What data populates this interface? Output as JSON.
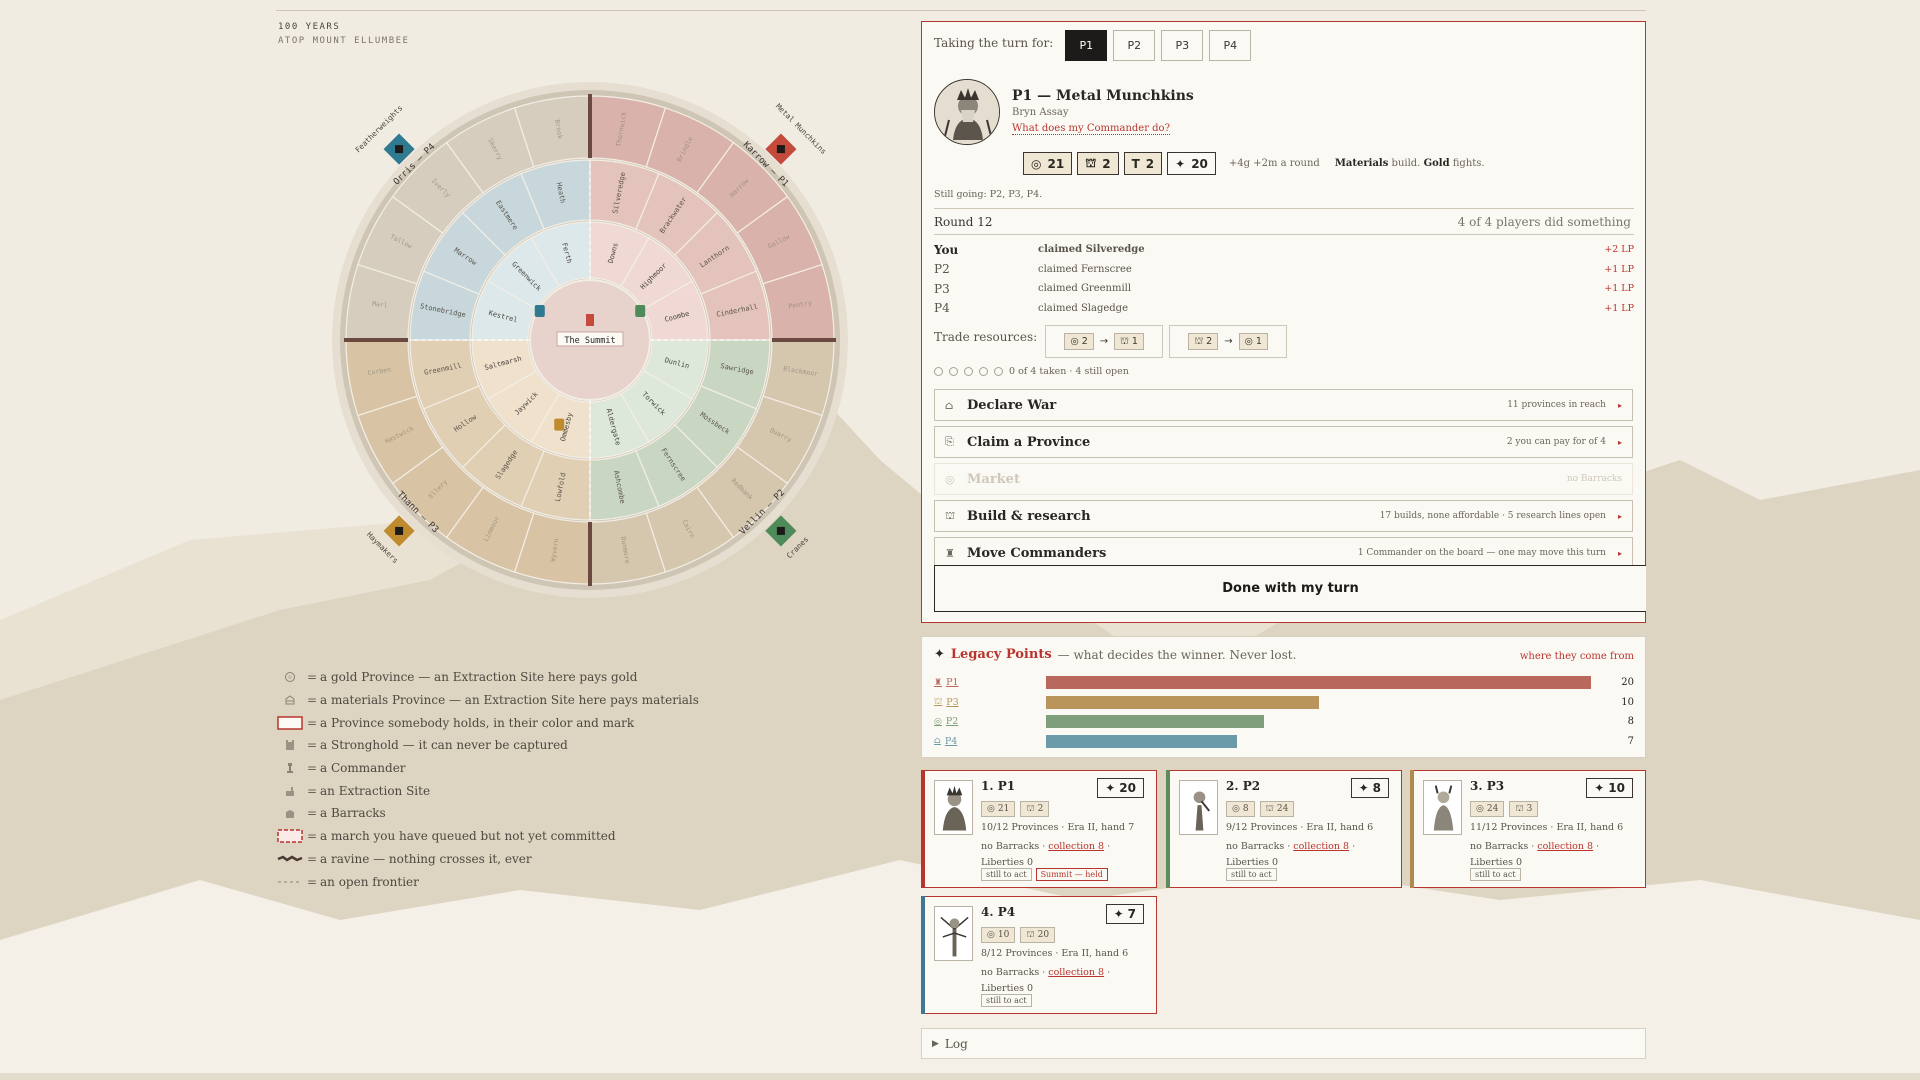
{
  "header": {
    "line1": "100 YEARS",
    "line2": "ATOP MOUNT ELLUMBEE"
  },
  "board": {
    "center_label": "The Summit",
    "corners": {
      "nw_region": "Orris — P4",
      "nw_faction": "Featherweights",
      "ne_region": "Karrow — P1",
      "ne_faction": "Metal Munchkins",
      "sw_region": "Thann — P3",
      "sw_faction": "Haymakers",
      "se_region": "Vellin — P2",
      "se_faction": "Cranes"
    },
    "inner_ring": [
      "Downs",
      "Highmoor",
      "Coombe",
      "Dunlin",
      "Torwick",
      "Aldergate",
      "Ommesby",
      "Jaywick",
      "Saltmarsh",
      "Kestrel",
      "Greenwick",
      "Ferth"
    ],
    "middle_ring": [
      "Silveredge",
      "Brackwater",
      "Lanthorn",
      "Cinderhall",
      "Sawridge",
      "Mossbeck",
      "Fernscree",
      "Ashcombe",
      "Lowfold",
      "Slagedge",
      "Hollow",
      "Greenmill",
      "Stonebridge",
      "Marrow",
      "Eastmere",
      "Heath"
    ],
    "outer_ring": [
      "Thornwick",
      "Brindle",
      "Harrow",
      "Gallow",
      "Pentry",
      "Blackmoor",
      "Quarry",
      "Redbank",
      "Cairn",
      "Dunmore",
      "Wyvern",
      "Linmoor",
      "Ellery",
      "Hastwick",
      "Corben",
      "Marl",
      "Tallow",
      "Iverly",
      "Skerry",
      "Brook"
    ]
  },
  "legend": [
    {
      "icon": "gold-province-icon",
      "text": "a gold Province — an Extraction Site here pays gold"
    },
    {
      "icon": "materials-province-icon",
      "text": "a materials Province — an Extraction Site here pays materials"
    },
    {
      "icon": "held-province-swatch",
      "text": "a Province somebody holds, in their color and mark"
    },
    {
      "icon": "stronghold-icon",
      "text": "a Stronghold — it can never be captured"
    },
    {
      "icon": "commander-icon",
      "text": "a Commander"
    },
    {
      "icon": "extraction-site-icon",
      "text": "an Extraction Site"
    },
    {
      "icon": "barracks-icon",
      "text": "a Barracks"
    },
    {
      "icon": "queued-march-swatch",
      "text": "a march you have queued but not yet committed"
    },
    {
      "icon": "ravine-icon",
      "text": "a ravine — nothing crosses it, ever"
    },
    {
      "icon": "frontier-icon",
      "text": "an open frontier"
    }
  ],
  "turn": {
    "label": "Taking the turn for:",
    "players": [
      "P1",
      "P2",
      "P3",
      "P4"
    ],
    "active": "P1",
    "name": "P1 — Metal Munchkins",
    "commander": "Bryn Assay",
    "help_link": "What does my Commander do?",
    "gold": "21",
    "materials": "2",
    "troops": "2",
    "lp": "20",
    "income": "+4g +2m a round",
    "materials_word": "Materials",
    "build_word": "build.",
    "gold_word": "Gold",
    "fights_word": "fights.",
    "still_going": "Still going: P2, P3, P4.",
    "round": "Round 12",
    "round_note": "4 of 4 players did something",
    "activity": [
      {
        "who": "You",
        "what": "claimed Silveredge",
        "lp": "+2 LP"
      },
      {
        "who": "P2",
        "what": "claimed Fernscree",
        "lp": "+1 LP"
      },
      {
        "who": "P3",
        "what": "claimed Greenmill",
        "lp": "+1 LP"
      },
      {
        "who": "P4",
        "what": "claimed Slagedge",
        "lp": "+1 LP"
      }
    ],
    "trade_label": "Trade resources:",
    "trades": [
      {
        "give": "2",
        "get": "1"
      },
      {
        "give": "2",
        "get": "1"
      }
    ],
    "taken_note": "0 of 4 taken · 4 still open",
    "actions": [
      {
        "label": "Declare War",
        "note": "11 provinces in reach",
        "icon": "war-icon",
        "enabled": true
      },
      {
        "label": "Claim a Province",
        "note": "2 you can pay for of 4",
        "icon": "claim-icon",
        "enabled": true
      },
      {
        "label": "Market",
        "note": "no Barracks",
        "icon": "market-icon",
        "enabled": false
      },
      {
        "label": "Build & research",
        "note": "17 builds, none affordable · 5 research lines open",
        "icon": "build-icon",
        "enabled": true
      },
      {
        "label": "Move Commanders",
        "note": "1 Commander on the board — one may move this turn",
        "icon": "commander-icon",
        "enabled": true
      }
    ],
    "done_label": "Done with my turn"
  },
  "legacy": {
    "title": "Legacy Points",
    "subtitle": "— what decides the winner. Never lost.",
    "where": "where they come from",
    "rows": [
      {
        "player": "P1",
        "value": 20,
        "color": "#b9685e"
      },
      {
        "player": "P3",
        "value": 10,
        "color": "#b9955c"
      },
      {
        "player": "P2",
        "value": 8,
        "color": "#7f9f7c"
      },
      {
        "player": "P4",
        "value": 7,
        "color": "#6b9aa8"
      }
    ],
    "max": 20
  },
  "cards": [
    {
      "rank": "1. P1",
      "lp": "20",
      "gold": "21",
      "mat": "2",
      "l1": "10/12 Provinces · Era II, hand 7",
      "l2a": "no Barracks · ",
      "l2b": "collection 8",
      "l2c": " · Liberties 0",
      "tag1": "still to act",
      "tag2": "Summit — held",
      "color": "#b8352f"
    },
    {
      "rank": "2. P2",
      "lp": "8",
      "gold": "8",
      "mat": "24",
      "l1": "9/12 Provinces · Era II, hand 6",
      "l2a": "no Barracks · ",
      "l2b": "collection 8",
      "l2c": " · Liberties 0",
      "tag1": "still to act",
      "tag2": "",
      "color": "#5f8a5c"
    },
    {
      "rank": "3. P3",
      "lp": "10",
      "gold": "24",
      "mat": "3",
      "l1": "11/12 Provinces · Era II, hand 6",
      "l2a": "no Barracks · ",
      "l2b": "collection 8",
      "l2c": " · Liberties 0",
      "tag1": "still to act",
      "tag2": "",
      "color": "#b0894e"
    },
    {
      "rank": "4. P4",
      "lp": "7",
      "gold": "10",
      "mat": "20",
      "l1": "8/12 Provinces · Era II, hand 6",
      "l2a": "no Barracks · ",
      "l2b": "collection 8",
      "l2c": " · Liberties 0",
      "tag1": "still to act",
      "tag2": "",
      "color": "#3f7890"
    }
  ],
  "log_label": "Log",
  "colors": {
    "p1": "#c44a3c",
    "p2": "#4f8a5a",
    "p3": "#c08a2e",
    "p4": "#2f7a90",
    "accent": "#b8352f"
  }
}
